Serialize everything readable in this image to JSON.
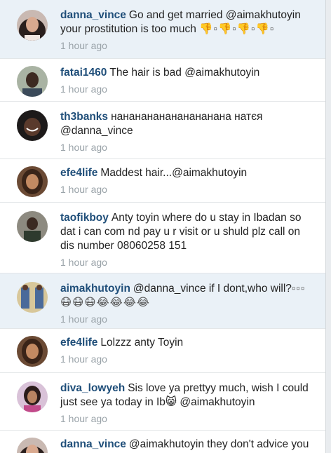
{
  "colors": {
    "username": "#1f4e79",
    "timestamp": "#9aa3a9",
    "highlight_bg": "#eaf1f7"
  },
  "comments": [
    {
      "username": "danna_vince",
      "text": "Go and get married @aimakhutoyin your prostitution is too much",
      "emoji": "👎▫👎▫👎▫👎▫",
      "time": "1 hour ago"
    },
    {
      "username": "fatai1460",
      "text": "The hair is bad @aimakhutoyin",
      "time": "1 hour ago"
    },
    {
      "username": "th3banks",
      "text": "нананананананананана натєя @danna_vince",
      "time": "1 hour ago"
    },
    {
      "username": "efe4life",
      "text": "Maddest hair...@aimakhutoyin",
      "time": "1 hour ago"
    },
    {
      "username": "taofikboy",
      "text": "Anty toyin where do u stay in Ibadan so dat i can com nd pay u r visit or u shuld plz call on dis number 08060258 151",
      "time": "1 hour ago"
    },
    {
      "username": "aimakhutoyin",
      "text": "@danna_vince if I dont,who will?",
      "emoji": "▫▫▫😷😷😷😂😂😂😂",
      "time": "1 hour ago"
    },
    {
      "username": "efe4life",
      "text": "Lolzzz anty Toyin",
      "time": "1 hour ago"
    },
    {
      "username": "diva_lowyeh",
      "text": "Sis love ya prettyy much, wish I could just see ya today in Ib",
      "emoji": "😸",
      "text2": "@aimakhutoyin",
      "time": "1 hour ago"
    },
    {
      "username": "danna_vince",
      "text": "@aimakhutoyin they don't advice you"
    }
  ]
}
